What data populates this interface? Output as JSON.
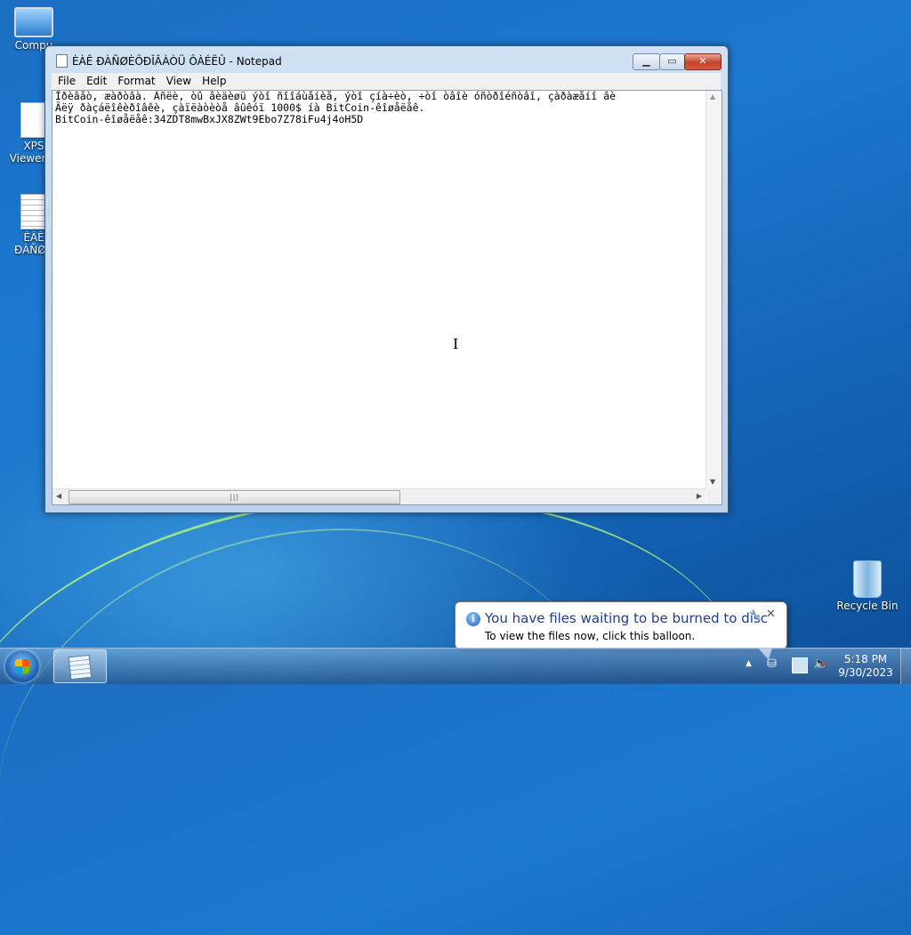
{
  "desktop": {
    "icons": [
      {
        "label": "Compu"
      },
      {
        "label": "XPS Viewer.In"
      },
      {
        "label": "ÈÀÊ ÐÀÑØÈÔ"
      },
      {
        "label": "Recycle Bin"
      }
    ]
  },
  "notepad": {
    "title": "ÈÀÊ ÐÀÑØÈÔÐÎÂÀÒÜ ÔÀÉËÛ - Notepad",
    "menu": [
      "File",
      "Edit",
      "Format",
      "View",
      "Help"
    ],
    "content": "Ïðèâåò, æàðòâà. Âñëè, òû âèäèøü ýòî ñîîáùåíèå, ýòî çíà÷èò, ÷òî òâîè óñòðîéñòâî, çàðàæåíî âè\nÄëÿ ðàçáëîêèðîâêè, çàïëàòèòå âûêóï 1000$ íà BitCoin-êîøåëåê.\nBitCoin-êîøåëåê:34ZDT8mwBxJX8ZWt9Ebo7Z78iFu4j4oH5D"
  },
  "balloon": {
    "title": "You have files waiting to be burned to disc",
    "text": "To view the files now, click this balloon."
  },
  "taskbar": {
    "time": "5:18 PM",
    "date": "9/30/2023"
  }
}
